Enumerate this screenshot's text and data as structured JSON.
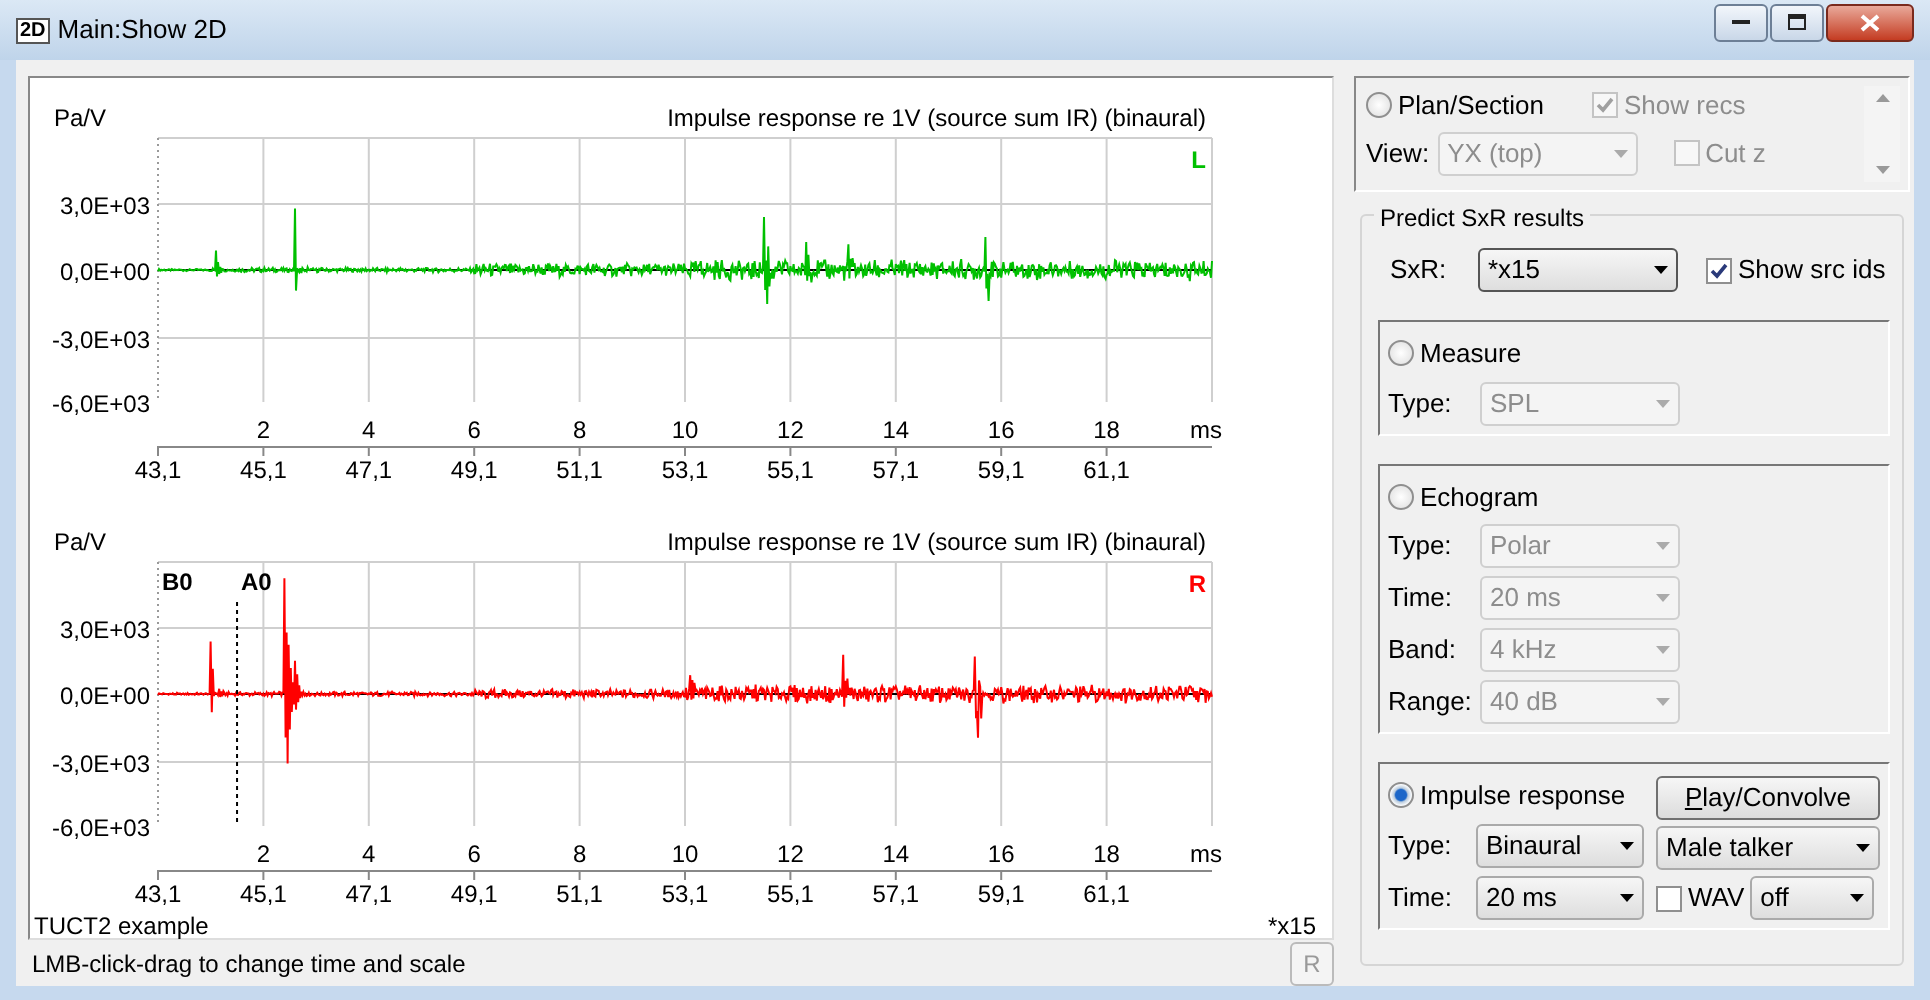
{
  "window": {
    "icon_text": "2D",
    "title": "Main:Show 2D"
  },
  "plots": [
    {
      "unit": "Pa/V",
      "title": "Impulse response re 1V (source sum IR)  (binaural)",
      "channel": "L",
      "color": "#00c000",
      "yticks": [
        "3,0E+03",
        "0,0E+00",
        "-3,0E+03",
        "-6,0E+03"
      ],
      "xticks": [
        "2",
        "4",
        "6",
        "8",
        "10",
        "12",
        "14",
        "16",
        "18"
      ],
      "xunit": "ms",
      "x2ticks": [
        "43,1",
        "45,1",
        "47,1",
        "49,1",
        "51,1",
        "53,1",
        "55,1",
        "57,1",
        "59,1",
        "61,1"
      ]
    },
    {
      "unit": "Pa/V",
      "title": "Impulse response re 1V (source sum IR)  (binaural)",
      "channel": "R",
      "color": "#ff0000",
      "yticks": [
        "3,0E+03",
        "0,0E+00",
        "-3,0E+03",
        "-6,0E+03"
      ],
      "xticks": [
        "2",
        "4",
        "6",
        "8",
        "10",
        "12",
        "14",
        "16",
        "18"
      ],
      "xunit": "ms",
      "x2ticks": [
        "43,1",
        "45,1",
        "47,1",
        "49,1",
        "51,1",
        "53,1",
        "55,1",
        "57,1",
        "59,1",
        "61,1"
      ],
      "markers": [
        {
          "label": "B0"
        },
        {
          "label": "A0"
        }
      ]
    }
  ],
  "plot_footer": {
    "example": "TUCT2 example",
    "scale": "*x15"
  },
  "status_bar": {
    "text": "LMB-click-drag to change time and scale",
    "button": "R",
    "button_disabled": true
  },
  "plan_section": {
    "radio": "Plan/Section",
    "selected": false,
    "show_recs": {
      "label": "Show recs",
      "checked": true,
      "disabled": true
    },
    "view_label": "View:",
    "view": "YX (top)",
    "cut_z": {
      "label": "Cut z",
      "checked": false,
      "disabled": true
    }
  },
  "predict": {
    "legend": "Predict SxR results",
    "sxr_label": "SxR:",
    "sxr": "*x15",
    "show_src_ids": {
      "label": "Show src ids",
      "checked": true,
      "disabled": false
    },
    "sections": [
      {
        "radio": "Measure",
        "selected": false,
        "fields": [
          {
            "label": "Type:",
            "value": "SPL",
            "disabled": true
          }
        ]
      },
      {
        "radio": "Echogram",
        "selected": false,
        "fields": [
          {
            "label": "Type:",
            "value": "Polar",
            "disabled": true
          },
          {
            "label": "Time:",
            "value": "20 ms",
            "disabled": true
          },
          {
            "label": "Band:",
            "value": "4 kHz",
            "disabled": true
          },
          {
            "label": "Range:",
            "value": "40 dB",
            "disabled": true
          }
        ]
      }
    ],
    "impulse": {
      "radio": "Impulse response",
      "selected": true,
      "button": "Play/Convolve",
      "fields": [
        {
          "label": "Type:",
          "value": "Binaural",
          "disabled": false
        },
        {
          "label": "Time:",
          "value": "20 ms",
          "disabled": false
        }
      ],
      "signal": "Male talker",
      "wav": {
        "label": "WAV",
        "checked": false,
        "disabled": false
      },
      "wav_mode": "off"
    }
  }
}
